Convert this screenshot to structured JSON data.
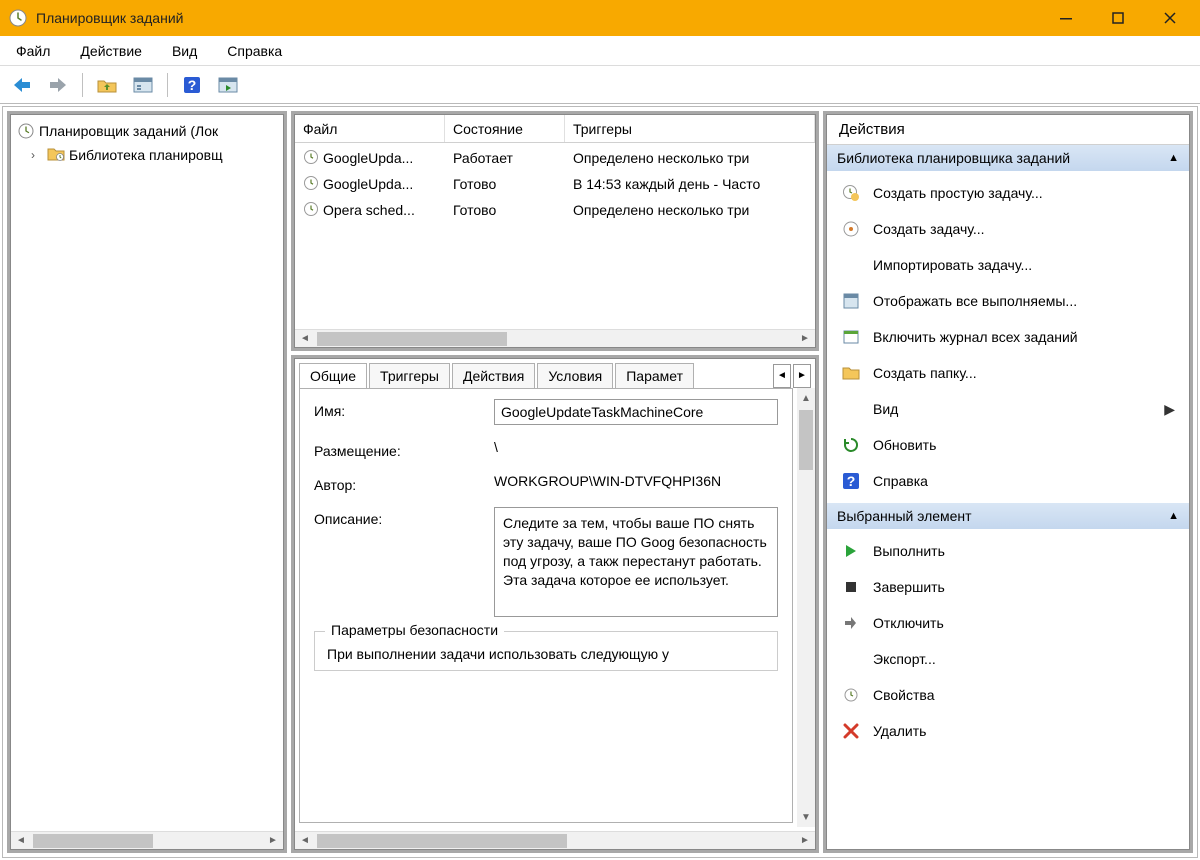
{
  "window": {
    "title": "Планировщик заданий"
  },
  "menu": {
    "items": [
      "Файл",
      "Действие",
      "Вид",
      "Справка"
    ]
  },
  "tree": {
    "root": "Планировщик заданий (Лок",
    "child": "Библиотека планировщ"
  },
  "taskTable": {
    "columns": {
      "c1": "Файл",
      "c2": "Состояние",
      "c3": "Триггеры"
    },
    "rows": [
      {
        "name": "GoogleUpda...",
        "state": "Работает",
        "triggers": "Определено несколько три"
      },
      {
        "name": "GoogleUpda...",
        "state": "Готово",
        "triggers": "В 14:53 каждый день - Часто"
      },
      {
        "name": "Opera sched...",
        "state": "Готово",
        "triggers": "Определено несколько три"
      }
    ]
  },
  "tabs": {
    "items": [
      "Общие",
      "Триггеры",
      "Действия",
      "Условия",
      "Парамет"
    ]
  },
  "general": {
    "nameLabel": "Имя:",
    "nameValue": "GoogleUpdateTaskMachineCore",
    "locationLabel": "Размещение:",
    "locationValue": "\\",
    "authorLabel": "Автор:",
    "authorValue": "WORKGROUP\\WIN-DTVFQHPI36N",
    "descLabel": "Описание:",
    "descValue": "Следите за тем, чтобы ваше ПО снять эту задачу, ваше ПО Goog безопасность под угрозу, а такж перестанут работать. Эта задача которое ее использует.",
    "securityGroup": "Параметры безопасности",
    "securityText": "При выполнении задачи использовать следующую у"
  },
  "actionsPane": {
    "title": "Действия",
    "section1": "Библиотека планировщика заданий",
    "items1": [
      "Создать простую задачу...",
      "Создать задачу...",
      "Импортировать задачу...",
      "Отображать все выполняемы...",
      "Включить журнал всех заданий",
      "Создать папку...",
      "Вид",
      "Обновить",
      "Справка"
    ],
    "section2": "Выбранный элемент",
    "items2": [
      "Выполнить",
      "Завершить",
      "Отключить",
      "Экспорт...",
      "Свойства",
      "Удалить"
    ]
  }
}
